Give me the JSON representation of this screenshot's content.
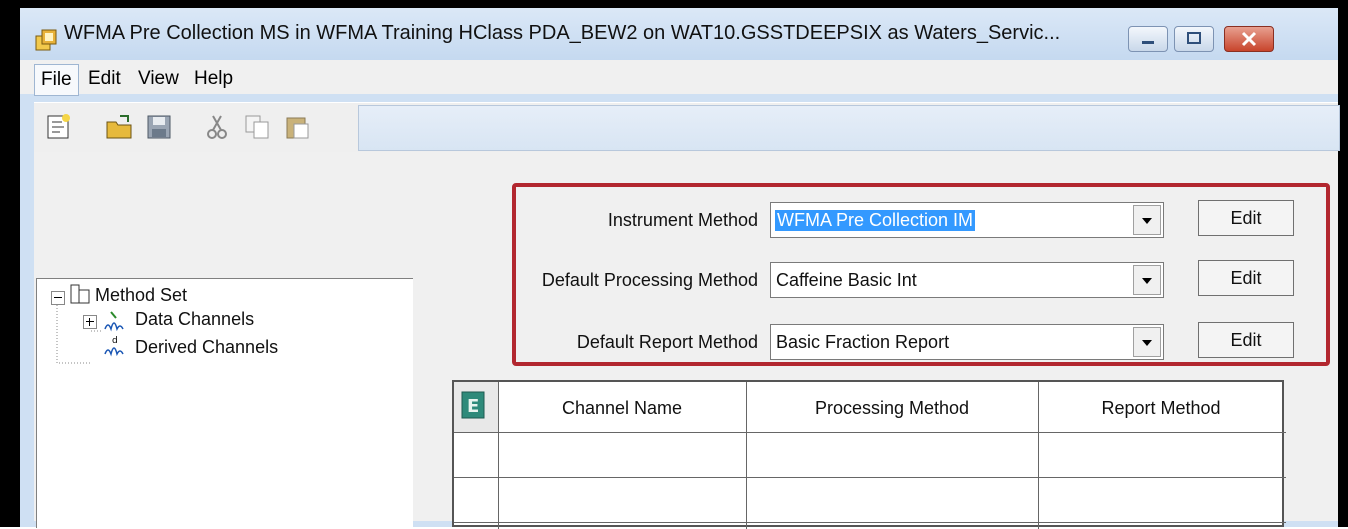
{
  "window": {
    "title": "WFMA Pre Collection MS in WFMA Training HClass PDA_BEW2 on WAT10.GSSTDEEPSIX as Waters_Servic..."
  },
  "menubar": {
    "items": [
      "File",
      "Edit",
      "View",
      "Help"
    ]
  },
  "toolbar": {
    "icons": [
      "new-icon",
      "open-icon",
      "save-icon",
      "cut-icon",
      "copy-icon",
      "paste-icon"
    ]
  },
  "tree": {
    "root": "Method Set",
    "children": [
      "Data Channels",
      "Derived Channels"
    ]
  },
  "methods": {
    "instrument_label": "Instrument Method",
    "instrument_value": "WFMA Pre Collection IM",
    "processing_label": "Default Processing Method",
    "processing_value": "Caffeine Basic Int",
    "report_label": "Default Report Method",
    "report_value": "Basic Fraction Report",
    "edit_label": "Edit"
  },
  "grid": {
    "columns": [
      "Channel Name",
      "Processing Method",
      "Report Method"
    ]
  },
  "colors": {
    "highlight_border": "#b2272f",
    "selection": "#3399ff"
  }
}
